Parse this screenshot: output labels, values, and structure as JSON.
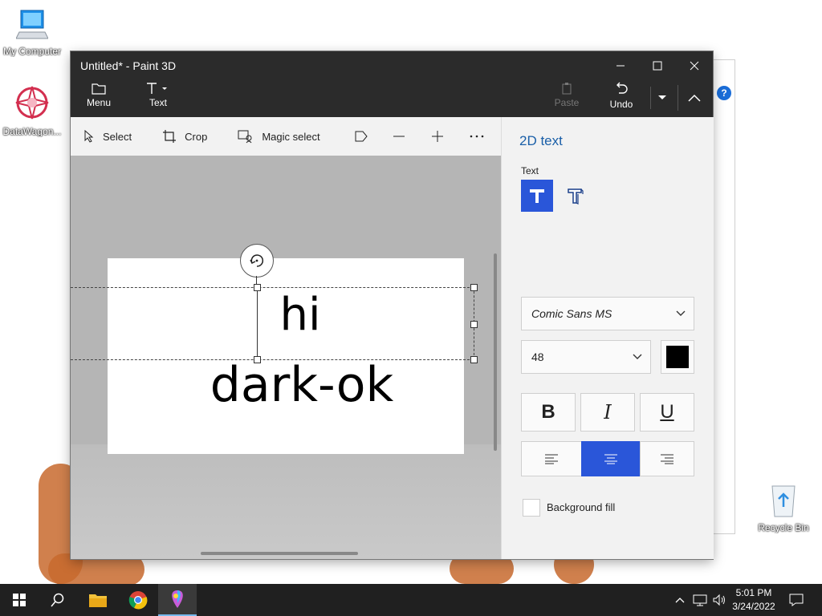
{
  "desktop": {
    "icons": [
      {
        "label": "My Computer",
        "icon": "computer-icon"
      },
      {
        "label": "DataWagon...",
        "icon": "datawagon-icon"
      },
      {
        "label": "Recycle Bin",
        "icon": "recycle-bin-icon"
      }
    ]
  },
  "window": {
    "title": "Untitled* - Paint 3D",
    "controls": [
      "minimize-icon",
      "maximize-icon",
      "close-icon"
    ],
    "menu_label": "Menu",
    "text_label": "Text",
    "paste_label": "Paste",
    "undo_label": "Undo"
  },
  "toolbar": {
    "select": "Select",
    "crop": "Crop",
    "magic_select": "Magic select"
  },
  "canvas": {
    "line1": "hi",
    "line2": "dark-ok"
  },
  "panel": {
    "heading": "2D text",
    "text_label": "Text",
    "font": "Comic Sans MS",
    "size": "48",
    "bold": "B",
    "italic": "I",
    "underline": "U",
    "selected_alignment": "center",
    "background_fill_label": "Background fill",
    "background_fill_checked": false,
    "text_color": "#000000",
    "accent": "#2a56d9"
  },
  "taskbar": {
    "time": "5:01 PM",
    "date": "3/24/2022"
  }
}
